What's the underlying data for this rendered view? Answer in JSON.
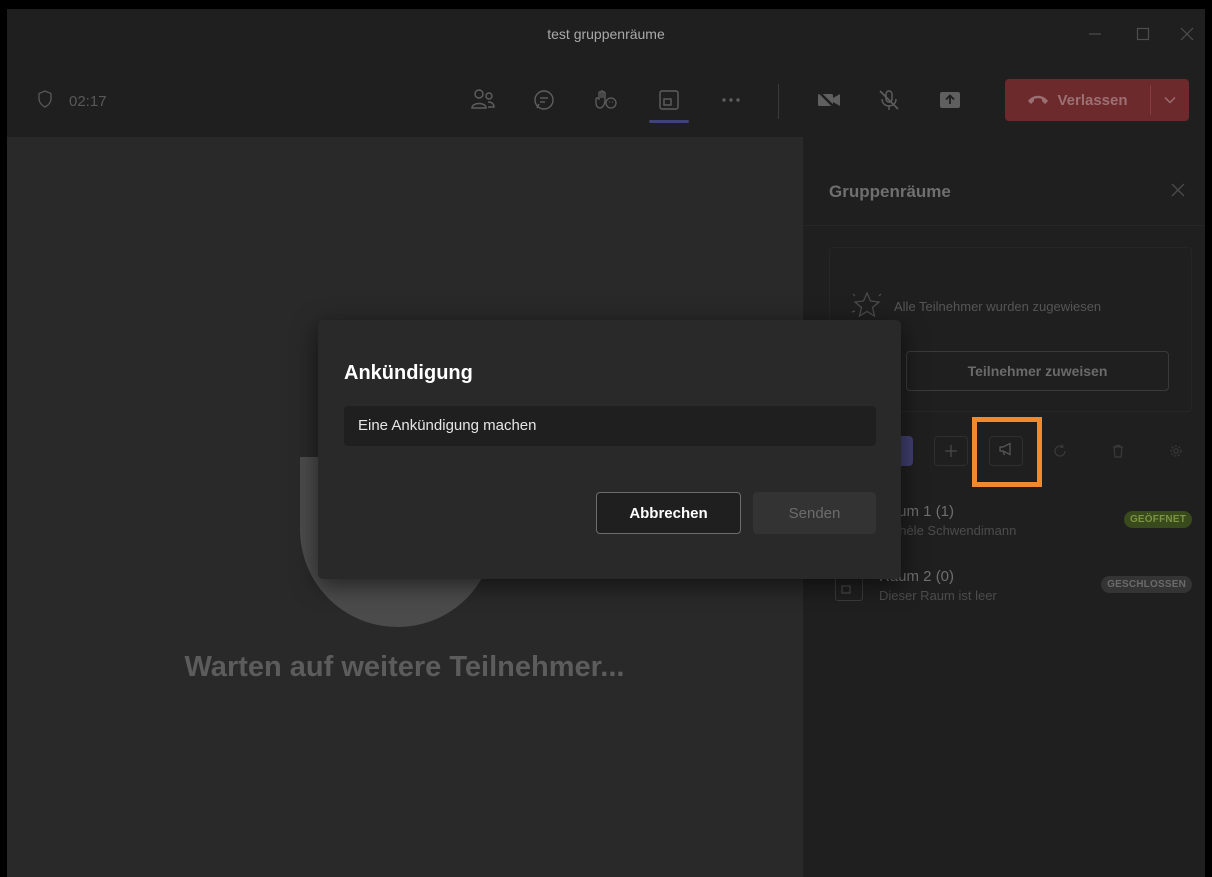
{
  "window": {
    "title": "test gruppenräume",
    "minimize_icon": "minimize-icon",
    "maximize_icon": "maximize-icon",
    "close_icon": "close-icon"
  },
  "toolbar": {
    "timer": "02:17",
    "shield_icon": "shield-icon",
    "icons": [
      "people-icon",
      "chat-icon",
      "raise-hand-icon",
      "breakout-rooms-icon",
      "more-icon",
      "camera-off-icon",
      "mic-off-icon",
      "share-icon"
    ],
    "leave_label": "Verlassen",
    "leave_color": "#6d2a2d"
  },
  "stage": {
    "waiting_text": "Warten auf weitere Teilnehmer..."
  },
  "panel": {
    "title": "Gruppenräume",
    "assign_info": "Alle Teilnehmer wurden zugewiesen",
    "assign_button": "Teilnehmer zuweisen",
    "rooms": [
      {
        "name": "Raum 1 (1)",
        "sub": "Michèle Schwendimann",
        "status": "GEÖFFNET"
      },
      {
        "name": "Raum 2 (0)",
        "sub": "Dieser Raum ist leer",
        "status": "GESCHLOSSEN"
      }
    ]
  },
  "dialog": {
    "title": "Ankündigung",
    "input_value": "Eine Ankündigung machen",
    "cancel_label": "Abbrechen",
    "send_label": "Senden"
  },
  "highlight_color": "#f08a2c"
}
